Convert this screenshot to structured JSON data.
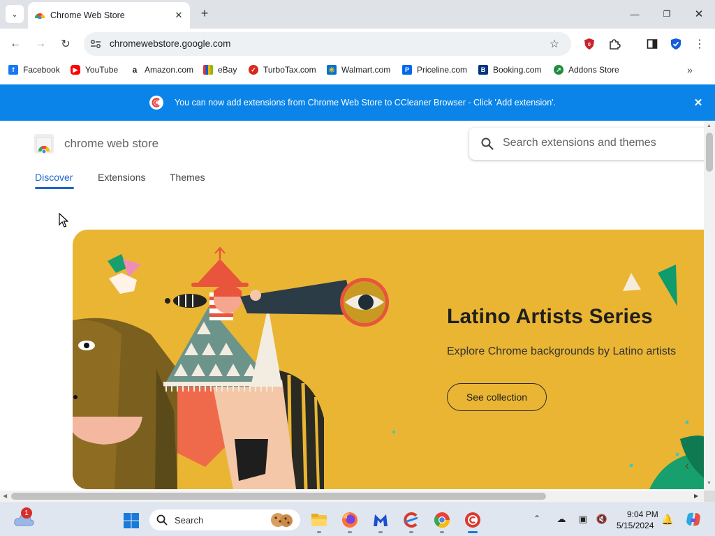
{
  "browser": {
    "tab": {
      "title": "Chrome Web Store"
    },
    "url": "chromewebstore.google.com",
    "bookmarks": [
      {
        "label": "Facebook",
        "icon": "facebook-icon",
        "color": "#1877f2"
      },
      {
        "label": "YouTube",
        "icon": "youtube-icon",
        "color": "#ff0000"
      },
      {
        "label": "Amazon.com",
        "icon": "amazon-icon",
        "color": "#222222"
      },
      {
        "label": "eBay",
        "icon": "ebay-icon",
        "color": "#e53238"
      },
      {
        "label": "TurboTax.com",
        "icon": "turbotax-icon",
        "color": "#d52b1e"
      },
      {
        "label": "Walmart.com",
        "icon": "walmart-icon",
        "color": "#0071ce"
      },
      {
        "label": "Priceline.com",
        "icon": "priceline-icon",
        "color": "#0068ef"
      },
      {
        "label": "Booking.com",
        "icon": "booking-icon",
        "color": "#003580"
      },
      {
        "label": "Addons Store",
        "icon": "addons-store-icon",
        "color": "#1e8e3e"
      }
    ]
  },
  "banner": {
    "text": "You can now add extensions from Chrome Web Store to CCleaner Browser - Click 'Add extension'.",
    "color": "#0a84e8"
  },
  "store": {
    "name": "chrome web store",
    "search_placeholder": "Search extensions and themes",
    "tabs": [
      "Discover",
      "Extensions",
      "Themes"
    ],
    "active_tab": "Discover",
    "accent": "#1a66c9"
  },
  "hero": {
    "title": "Latino Artists Series",
    "subtitle": "Explore Chrome backgrounds by Latino artists",
    "button": "See collection",
    "background": "#eab533"
  },
  "taskbar": {
    "search_label": "Search",
    "weather_badge": "1",
    "time": "9:04 PM",
    "date": "5/15/2024",
    "apps": [
      "file-explorer-icon",
      "firefox-icon",
      "malwarebytes-icon",
      "ccleaner-icon",
      "chrome-icon",
      "ccleaner-browser-icon"
    ]
  }
}
